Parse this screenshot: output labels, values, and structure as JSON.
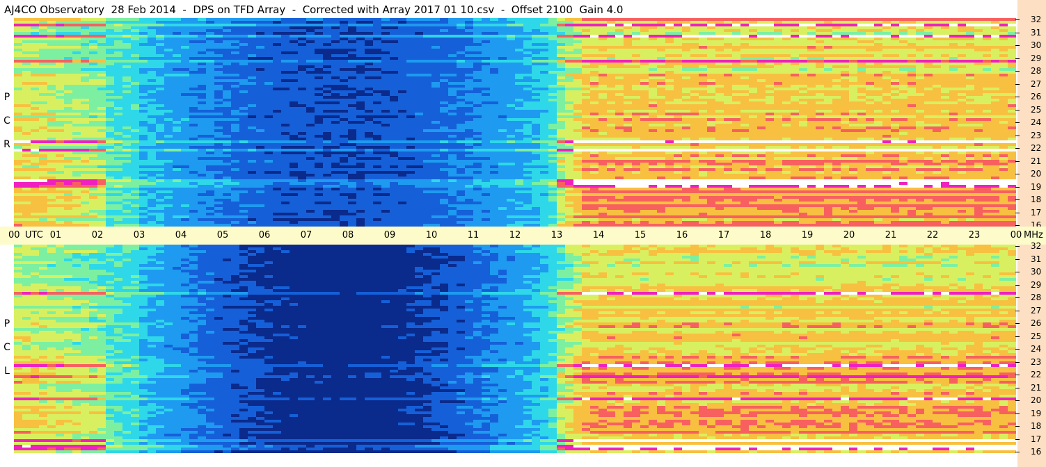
{
  "title": "AJ4CO Observatory  28 Feb 2014  -  DPS on TFD Array  -  Corrected with Array 2017 01 10.csv  -  Offset 2100  Gain 4.0",
  "chart_data": {
    "type": "heatmap",
    "title": "AJ4CO Observatory  28 Feb 2014  -  DPS on TFD Array  -  Corrected with Array 2017 01 10.csv  -  Offset 2100  Gain 4.0",
    "x_axis": {
      "tick_labels": [
        "00",
        "01",
        "02",
        "03",
        "04",
        "05",
        "06",
        "07",
        "08",
        "09",
        "10",
        "11",
        "12",
        "13",
        "14",
        "15",
        "16",
        "17",
        "18",
        "19",
        "20",
        "21",
        "22",
        "23",
        "00"
      ],
      "range": [
        0,
        24
      ],
      "unit": "UTC"
    },
    "y_axis": {
      "tick_labels": [
        "16",
        "17",
        "18",
        "19",
        "20",
        "21",
        "22",
        "23",
        "24",
        "25",
        "26",
        "27",
        "28",
        "29",
        "30",
        "31",
        "32"
      ],
      "range": [
        16,
        32
      ],
      "unit": "MHz"
    },
    "panels": [
      {
        "label": [
          "R",
          "C",
          "P"
        ]
      },
      {
        "label": [
          "L",
          "C",
          "P"
        ]
      }
    ],
    "colormap": [
      "#0a2a8c",
      "#1560d8",
      "#1e9af0",
      "#2ed8e8",
      "#7cf0a0",
      "#d8f060",
      "#f8c040",
      "#f86060",
      "#f020c0",
      "#ffffff"
    ],
    "grid": false,
    "legend": "none"
  }
}
